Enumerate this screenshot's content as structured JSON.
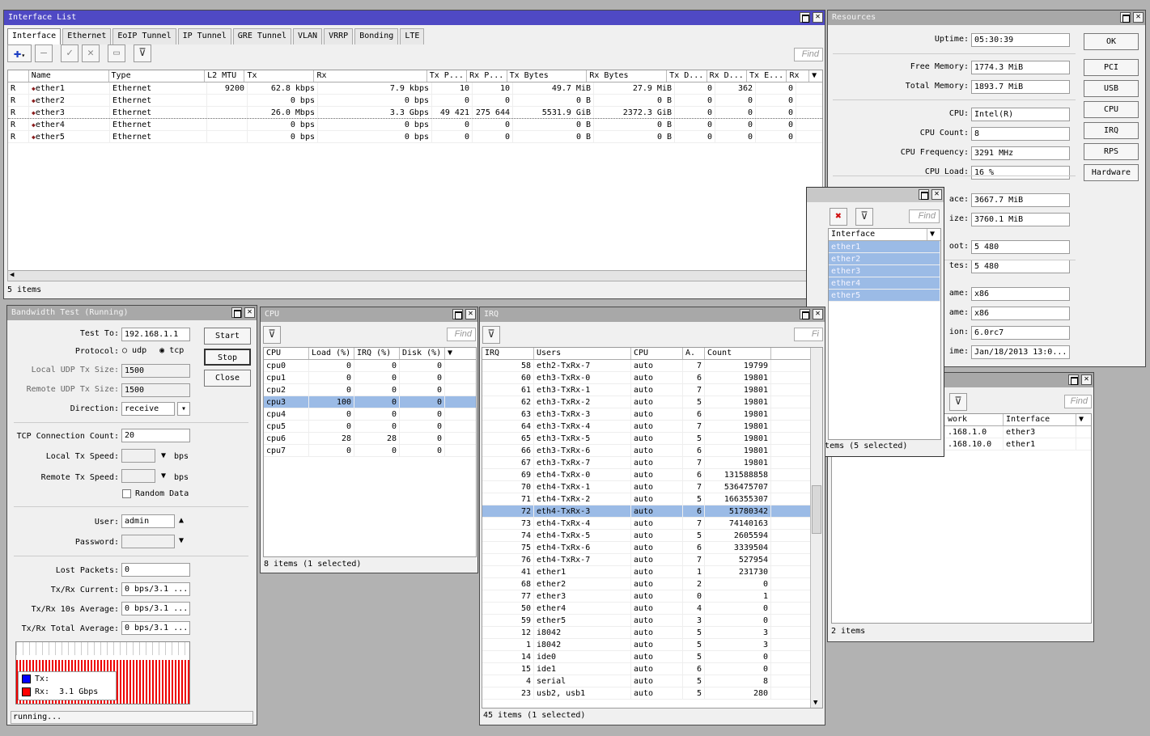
{
  "interface_list": {
    "title": "Interface List",
    "tabs": [
      "Interface",
      "Ethernet",
      "EoIP Tunnel",
      "IP Tunnel",
      "GRE Tunnel",
      "VLAN",
      "VRRP",
      "Bonding",
      "LTE"
    ],
    "find": "Find",
    "columns": [
      "",
      "Name",
      "Type",
      "L2 MTU",
      "Tx",
      "Rx",
      "Tx P...",
      "Rx P...",
      "Tx Bytes",
      "Rx Bytes",
      "Tx D...",
      "Rx D...",
      "Tx E...",
      "Rx"
    ],
    "rows": [
      [
        "R",
        "ether1",
        "Ethernet",
        "9200",
        "62.8 kbps",
        "7.9 kbps",
        "10",
        "10",
        "49.7 MiB",
        "27.9 MiB",
        "0",
        "362",
        "0"
      ],
      [
        "R",
        "ether2",
        "Ethernet",
        "",
        "0 bps",
        "0 bps",
        "0",
        "0",
        "0 B",
        "0 B",
        "0",
        "0",
        "0"
      ],
      [
        "R",
        "ether3",
        "Ethernet",
        "",
        "26.0 Mbps",
        "3.3 Gbps",
        "49 421",
        "275 644",
        "5531.9 GiB",
        "2372.3 GiB",
        "0",
        "0",
        "0"
      ],
      [
        "R",
        "ether4",
        "Ethernet",
        "",
        "0 bps",
        "0 bps",
        "0",
        "0",
        "0 B",
        "0 B",
        "0",
        "0",
        "0"
      ],
      [
        "R",
        "ether5",
        "Ethernet",
        "",
        "0 bps",
        "0 bps",
        "0",
        "0",
        "0 B",
        "0 B",
        "0",
        "0",
        "0"
      ]
    ],
    "status": "5 items"
  },
  "resources": {
    "title": "Resources",
    "labels": [
      "Uptime:",
      "Free Memory:",
      "Total Memory:",
      "CPU:",
      "CPU Count:",
      "CPU Frequency:",
      "CPU Load:",
      "ace:",
      "ize:",
      "oot:",
      "tes:",
      "ame:",
      "ame:",
      "ion:",
      "ime:"
    ],
    "values": [
      "05:30:39",
      "1774.3 MiB",
      "1893.7 MiB",
      "Intel(R)",
      "8",
      "3291 MHz",
      "16 %",
      "3667.7 MiB",
      "3760.1 MiB",
      "5 480",
      "5 480",
      "x86",
      "x86",
      "6.0rc7",
      "Jan/18/2013 13:0..."
    ],
    "buttons": [
      "OK",
      "PCI",
      "USB",
      "CPU",
      "IRQ",
      "RPS",
      "Hardware"
    ]
  },
  "iface_popup": {
    "find": "Find",
    "column": "Interface",
    "items": [
      "ether1",
      "ether2",
      "ether3",
      "ether4",
      "ether5"
    ],
    "status": "5 items (5 selected)"
  },
  "bandwidth_test": {
    "title": "Bandwidth Test (Running)",
    "test_to_label": "Test To:",
    "test_to": "192.168.1.1",
    "protocol_label": "Protocol:",
    "udp": "udp",
    "tcp": "tcp",
    "local_udp_label": "Local UDP Tx Size:",
    "local_udp": "1500",
    "remote_udp_label": "Remote UDP Tx Size:",
    "remote_udp": "1500",
    "direction_label": "Direction:",
    "direction": "receive",
    "tcp_count_label": "TCP Connection Count:",
    "tcp_count": "20",
    "local_speed_label": "Local Tx Speed:",
    "remote_speed_label": "Remote Tx Speed:",
    "bps": "bps",
    "random_data": "Random Data",
    "user_label": "User:",
    "user": "admin",
    "password_label": "Password:",
    "lost_label": "Lost Packets:",
    "lost": "0",
    "current_label": "Tx/Rx Current:",
    "current": "0 bps/3.1 ...",
    "avg10_label": "Tx/Rx 10s Average:",
    "avg10": "0 bps/3.1 ...",
    "total_label": "Tx/Rx Total Average:",
    "total": "0 bps/3.1 ...",
    "legend_tx": "Tx:",
    "legend_rx": "Rx:",
    "legend_rx_value": "3.1 Gbps",
    "start": "Start",
    "stop": "Stop",
    "close": "Close",
    "status": "running...",
    "colors": {
      "tx": "#0000ff",
      "rx": "#ff0000"
    }
  },
  "cpu": {
    "title": "CPU",
    "find": "Find",
    "columns": [
      "CPU",
      "Load (%)",
      "IRQ (%)",
      "Disk (%)"
    ],
    "rows": [
      [
        "cpu0",
        "0",
        "0",
        "0"
      ],
      [
        "cpu1",
        "0",
        "0",
        "0"
      ],
      [
        "cpu2",
        "0",
        "0",
        "0"
      ],
      [
        "cpu3",
        "100",
        "0",
        "0"
      ],
      [
        "cpu4",
        "0",
        "0",
        "0"
      ],
      [
        "cpu5",
        "0",
        "0",
        "0"
      ],
      [
        "cpu6",
        "28",
        "28",
        "0"
      ],
      [
        "cpu7",
        "0",
        "0",
        "0"
      ]
    ],
    "selected": 3,
    "status": "8 items (1 selected)"
  },
  "irq": {
    "title": "IRQ",
    "find": "Fi",
    "columns": [
      "IRQ",
      "Users",
      "CPU",
      "A.",
      "Count"
    ],
    "rows": [
      [
        "58",
        "eth2-TxRx-7",
        "auto",
        "7",
        "19799"
      ],
      [
        "60",
        "eth3-TxRx-0",
        "auto",
        "6",
        "19801"
      ],
      [
        "61",
        "eth3-TxRx-1",
        "auto",
        "7",
        "19801"
      ],
      [
        "62",
        "eth3-TxRx-2",
        "auto",
        "5",
        "19801"
      ],
      [
        "63",
        "eth3-TxRx-3",
        "auto",
        "6",
        "19801"
      ],
      [
        "64",
        "eth3-TxRx-4",
        "auto",
        "7",
        "19801"
      ],
      [
        "65",
        "eth3-TxRx-5",
        "auto",
        "5",
        "19801"
      ],
      [
        "66",
        "eth3-TxRx-6",
        "auto",
        "6",
        "19801"
      ],
      [
        "67",
        "eth3-TxRx-7",
        "auto",
        "7",
        "19801"
      ],
      [
        "69",
        "eth4-TxRx-0",
        "auto",
        "6",
        "131588858"
      ],
      [
        "70",
        "eth4-TxRx-1",
        "auto",
        "7",
        "536475707"
      ],
      [
        "71",
        "eth4-TxRx-2",
        "auto",
        "5",
        "166355307"
      ],
      [
        "72",
        "eth4-TxRx-3",
        "auto",
        "6",
        "51780342"
      ],
      [
        "73",
        "eth4-TxRx-4",
        "auto",
        "7",
        "74140163"
      ],
      [
        "74",
        "eth4-TxRx-5",
        "auto",
        "5",
        "2605594"
      ],
      [
        "75",
        "eth4-TxRx-6",
        "auto",
        "6",
        "3339504"
      ],
      [
        "76",
        "eth4-TxRx-7",
        "auto",
        "7",
        "527954"
      ],
      [
        "41",
        "ether1",
        "auto",
        "1",
        "231730"
      ],
      [
        "68",
        "ether2",
        "auto",
        "2",
        "0"
      ],
      [
        "77",
        "ether3",
        "auto",
        "0",
        "1"
      ],
      [
        "50",
        "ether4",
        "auto",
        "4",
        "0"
      ],
      [
        "59",
        "ether5",
        "auto",
        "3",
        "0"
      ],
      [
        "12",
        "i8042",
        "auto",
        "5",
        "3"
      ],
      [
        "1",
        "i8042",
        "auto",
        "5",
        "3"
      ],
      [
        "14",
        "ide0",
        "auto",
        "5",
        "0"
      ],
      [
        "15",
        "ide1",
        "auto",
        "6",
        "0"
      ],
      [
        "4",
        "serial",
        "auto",
        "5",
        "8"
      ],
      [
        "23",
        "usb2, usb1",
        "auto",
        "5",
        "280"
      ]
    ],
    "selected": 12,
    "status": "45 items (1 selected)"
  },
  "routes": {
    "find": "Find",
    "columns": [
      "work",
      "Interface"
    ],
    "rows": [
      [
        ".168.1.0",
        "ether3"
      ],
      [
        ".168.10.0",
        "ether1"
      ]
    ],
    "status": "2 items"
  }
}
